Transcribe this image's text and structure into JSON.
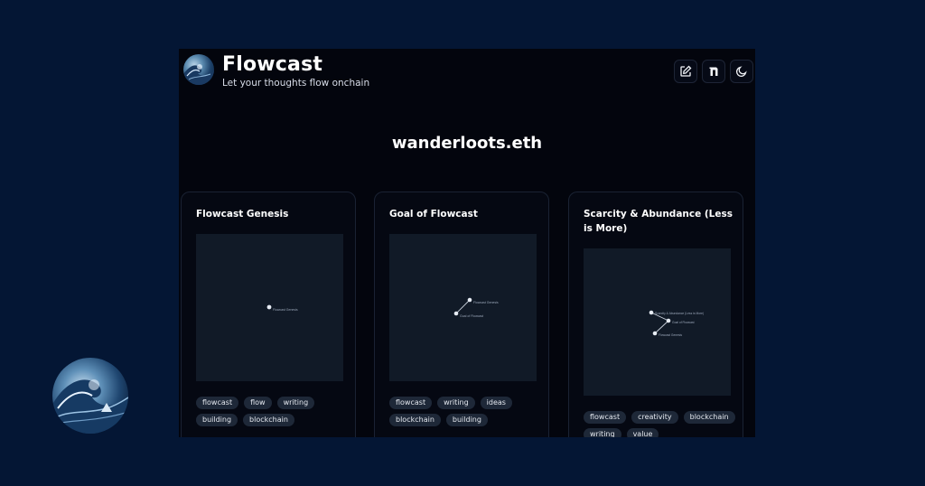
{
  "app": {
    "title": "Flowcast",
    "subtitle": "Let your thoughts flow onchain"
  },
  "header": {
    "actions": [
      {
        "name": "edit-icon"
      },
      {
        "name": "notion-icon"
      },
      {
        "name": "moon-icon"
      }
    ]
  },
  "profile": {
    "name": "wanderloots.eth"
  },
  "cards": [
    {
      "title": "Flowcast Genesis",
      "graph_nodes": [
        "Flowcast Genesis"
      ],
      "tags": [
        "flowcast",
        "flow",
        "writing",
        "building",
        "blockchain"
      ]
    },
    {
      "title": "Goal of Flowcast",
      "graph_nodes": [
        "Flowcast Genesis",
        "Goal of Flowcast"
      ],
      "tags": [
        "flowcast",
        "writing",
        "ideas",
        "blockchain",
        "building"
      ]
    },
    {
      "title": "Scarcity & Abundance (Less is More)",
      "graph_nodes": [
        "Scarcity & Abundance (Less is More)",
        "Goal of Flowcast",
        "Flowcast Genesis"
      ],
      "tags": [
        "flowcast",
        "creativity",
        "blockchain",
        "writing",
        "value"
      ]
    }
  ],
  "colors": {
    "page_background": "#041634",
    "app_background": "#03050d",
    "graph_background": "#111a27",
    "tag_background": "#1e2838"
  }
}
